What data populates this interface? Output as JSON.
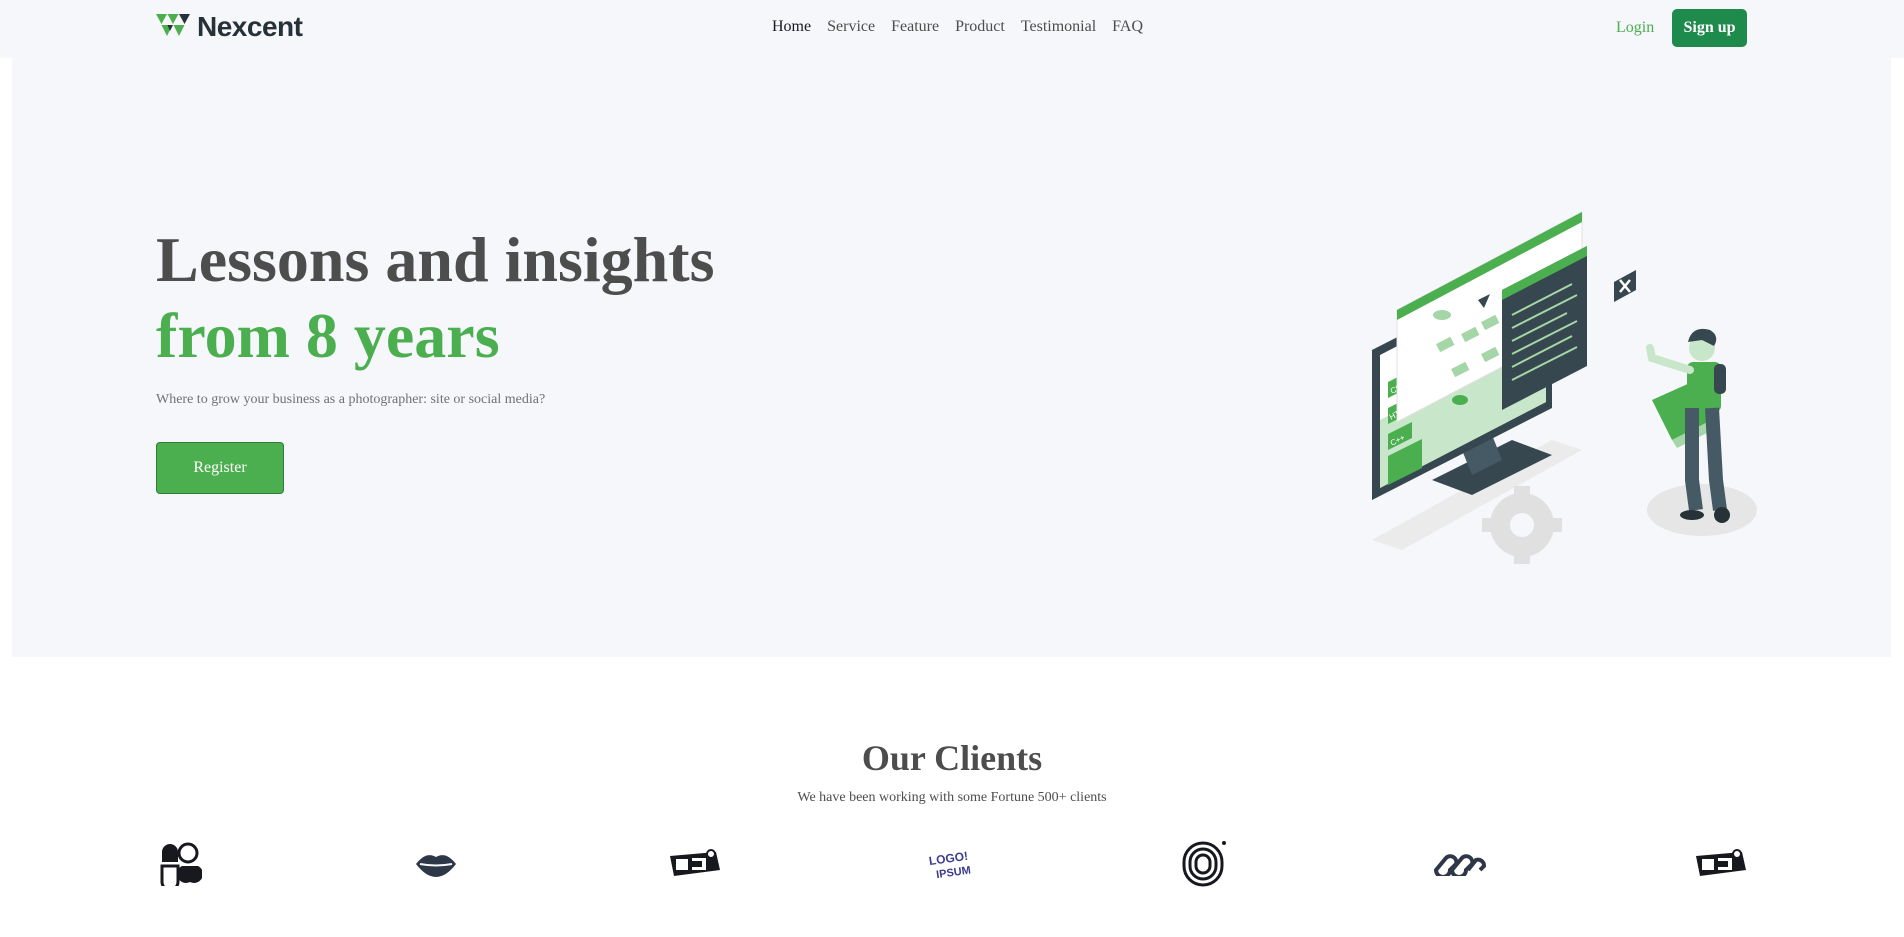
{
  "brand": {
    "name": "Nexcent",
    "logo_icon": "triangle-logo-icon",
    "accent": "#4caf4f",
    "accent_dark": "#1e8a4c"
  },
  "nav": {
    "items": [
      {
        "label": "Home",
        "active": true
      },
      {
        "label": "Service"
      },
      {
        "label": "Feature"
      },
      {
        "label": "Product"
      },
      {
        "label": "Testimonial"
      },
      {
        "label": "FAQ"
      }
    ],
    "login_label": "Login",
    "signup_label": "Sign up"
  },
  "hero": {
    "title_line1": "Lessons and insights",
    "title_line2": "from 8 years",
    "subtitle": "Where to grow your business as a photographer: site or social media?",
    "cta_label": "Register",
    "illustration": "developer-with-monitor-illustration",
    "illustration_text": {
      "css": "CSS",
      "html": "HTML",
      "cpp": "C++"
    }
  },
  "clients": {
    "title": "Our Clients",
    "subtitle": "We have been working with some Fortune 500+ clients",
    "logos": [
      "shapes-logo-icon",
      "lips-logo-icon",
      "oo-badge-logo-icon",
      "logo-ipsum-logo-icon",
      "fingerprint-logo-icon",
      "chain-logo-icon",
      "oo-badge-logo-icon"
    ],
    "logo_ipsum_text": [
      "LOGO!",
      "IPSUM"
    ]
  }
}
